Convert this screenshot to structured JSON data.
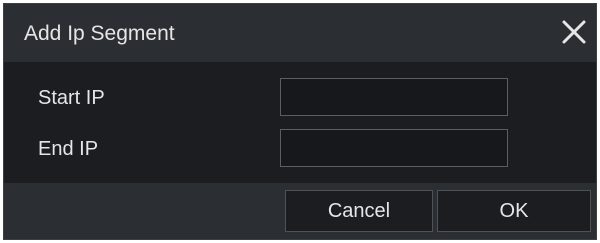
{
  "dialog": {
    "title": "Add Ip Segment",
    "close_icon": "close-icon"
  },
  "fields": {
    "start_ip": {
      "label": "Start IP",
      "value": ""
    },
    "end_ip": {
      "label": "End IP",
      "value": ""
    }
  },
  "buttons": {
    "cancel_label": "Cancel",
    "ok_label": "OK"
  },
  "colors": {
    "dialog_bg": "#1b1d21",
    "bar_bg": "#2b2e33",
    "text": "#e6e6e6",
    "input_border": "#5a5d62"
  }
}
